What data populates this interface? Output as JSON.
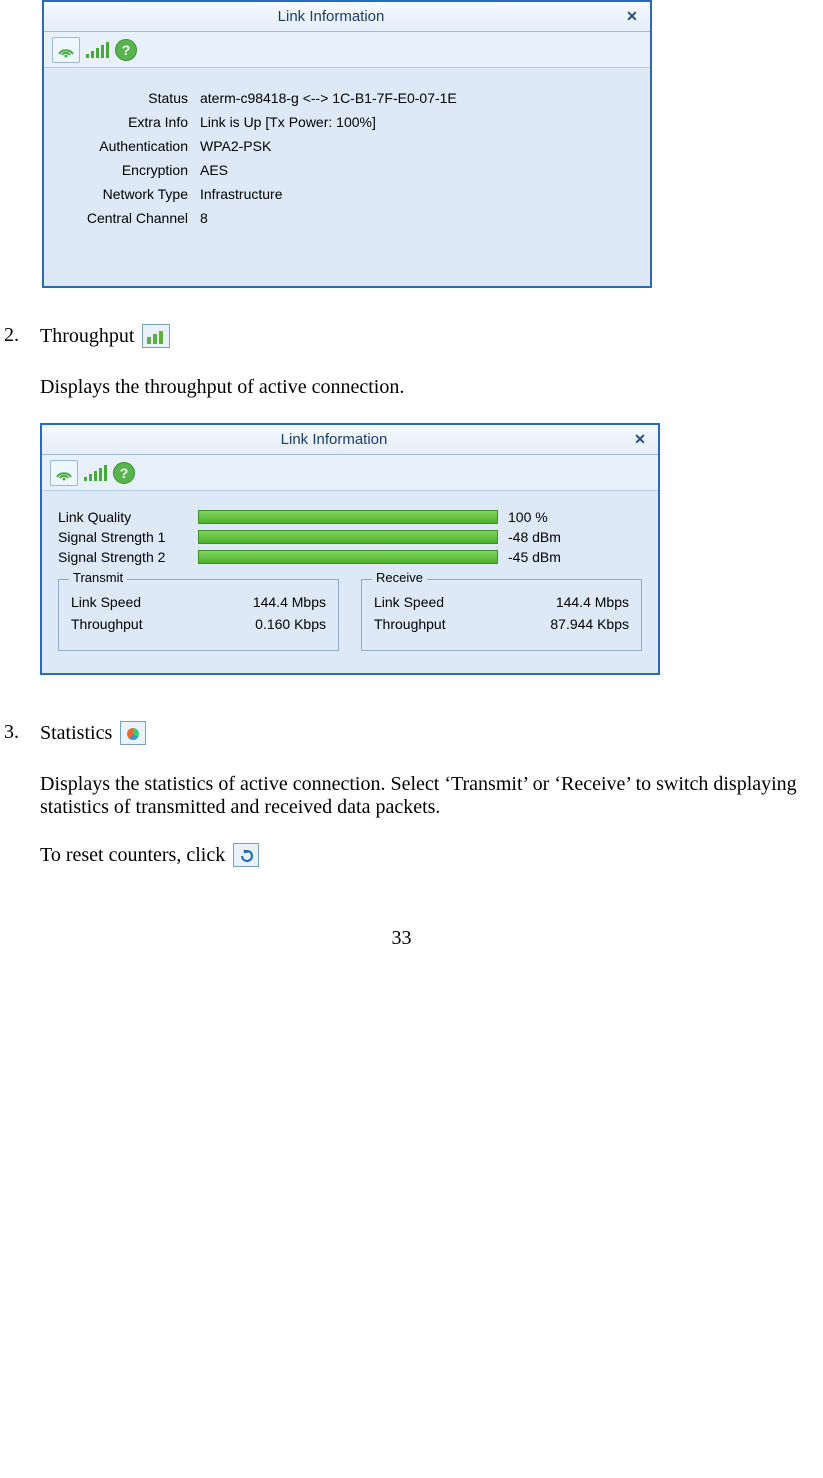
{
  "dialog1": {
    "title": "Link Information",
    "rows": {
      "status": {
        "label": "Status",
        "value": "aterm-c98418-g <--> 1C-B1-7F-E0-07-1E"
      },
      "extra": {
        "label": "Extra Info",
        "value": "Link is Up  [Tx Power: 100%]"
      },
      "auth": {
        "label": "Authentication",
        "value": "WPA2-PSK"
      },
      "enc": {
        "label": "Encryption",
        "value": "AES"
      },
      "net": {
        "label": "Network Type",
        "value": "Infrastructure"
      },
      "chan": {
        "label": "Central Channel",
        "value": "8"
      }
    }
  },
  "section2": {
    "number": "2.",
    "title": "Throughput",
    "desc": "Displays the throughput of active connection."
  },
  "dialog2": {
    "title": "Link Information",
    "bars": {
      "lq": {
        "label": "Link Quality",
        "value": "100 %",
        "pct": 100
      },
      "s1": {
        "label": "Signal Strength 1",
        "value": "-48 dBm",
        "pct": 100
      },
      "s2": {
        "label": "Signal Strength 2",
        "value": "-45 dBm",
        "pct": 100
      }
    },
    "tx": {
      "title": "Transmit",
      "link_label": "Link Speed",
      "link_val": "144.4 Mbps",
      "tp_label": "Throughput",
      "tp_val": "0.160 Kbps"
    },
    "rx": {
      "title": "Receive",
      "link_label": "Link Speed",
      "link_val": "144.4 Mbps",
      "tp_label": "Throughput",
      "tp_val": "87.944 Kbps"
    }
  },
  "section3": {
    "number": "3.",
    "title": "Statistics",
    "desc": "Displays the statistics of active connection. Select ‘Transmit’ or ‘Receive’ to switch displaying statistics of transmitted and received data packets.",
    "reset_text": "To reset counters, click"
  },
  "page_number": "33"
}
